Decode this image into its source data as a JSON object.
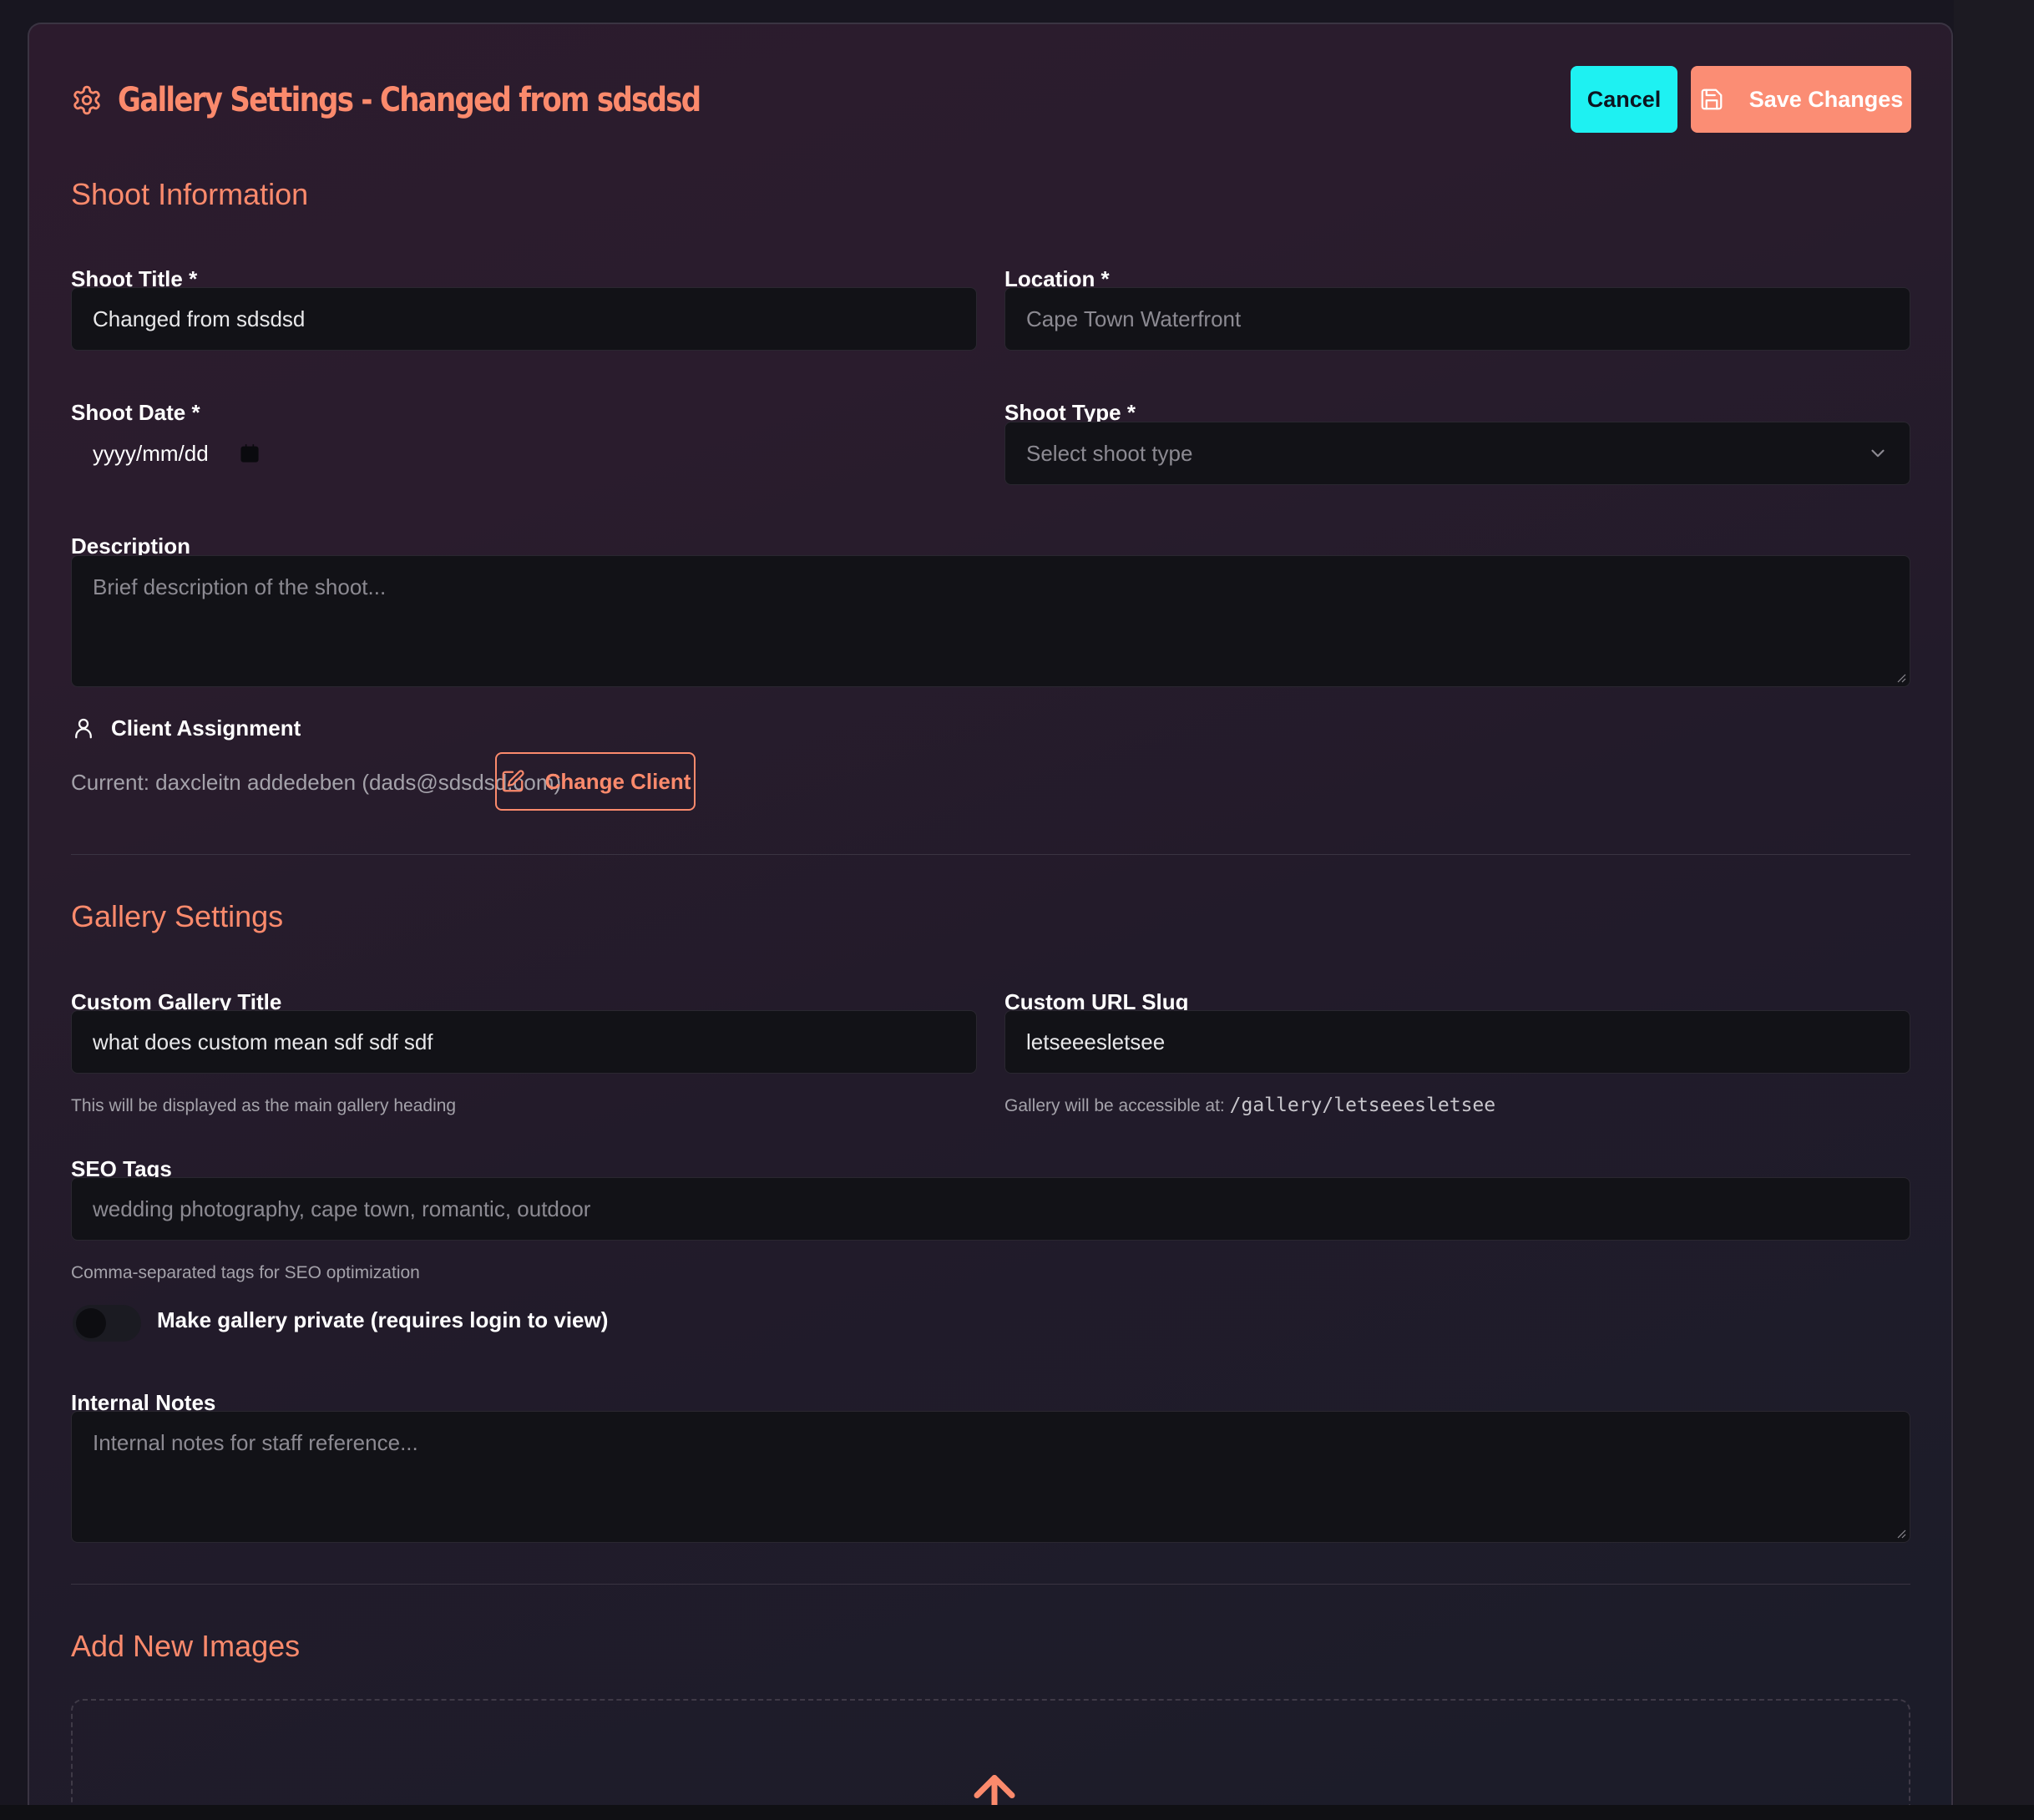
{
  "header": {
    "title": "Gallery Settings - Changed from sdsdsd",
    "cancel_label": "Cancel",
    "save_label": "Save Changes"
  },
  "shoot_info": {
    "section_title": "Shoot Information",
    "shoot_title": {
      "label": "Shoot Title *",
      "value": "Changed from sdsdsd"
    },
    "location": {
      "label": "Location *",
      "placeholder": "Cape Town Waterfront"
    },
    "shoot_date": {
      "label": "Shoot Date *",
      "placeholder": "yyyy/mm/dd"
    },
    "shoot_type": {
      "label": "Shoot Type *",
      "selected": "Select shoot type"
    },
    "description": {
      "label": "Description",
      "placeholder": "Brief description of the shoot..."
    },
    "client": {
      "label": "Client Assignment",
      "current": "Current: daxcleitn addedeben (dads@sdsdsd.com)",
      "change_label": "Change Client"
    }
  },
  "gallery_settings": {
    "section_title": "Gallery Settings",
    "custom_title": {
      "label": "Custom Gallery Title",
      "value": "what does custom mean sdf sdf sdf",
      "help": "This will be displayed as the main gallery heading"
    },
    "url_slug": {
      "label": "Custom URL Slug",
      "value": "letseeesletsee",
      "help_prefix": "Gallery will be accessible at:",
      "help_path": "/gallery/letseeesletsee"
    },
    "seo_tags": {
      "label": "SEO Tags",
      "placeholder": "wedding photography, cape town, romantic, outdoor",
      "help": "Comma-separated tags for SEO optimization"
    },
    "private": {
      "label": "Make gallery private (requires login to view)",
      "enabled": false
    },
    "internal_notes": {
      "label": "Internal Notes",
      "placeholder": "Internal notes for staff reference..."
    }
  },
  "add_images": {
    "section_title": "Add New Images"
  },
  "colors": {
    "accent": "#fb8a6c",
    "cancel_button": "#1ef1f2",
    "save_button": "#fb8d74",
    "field_bg": "#121217"
  },
  "icons": {
    "title": "gear-icon",
    "save": "floppy-disk-icon",
    "client": "user-icon",
    "change_client": "edit-icon",
    "calendar": "calendar-icon",
    "dropdown": "chevron-down-icon",
    "upload": "upload-arrow-icon"
  }
}
